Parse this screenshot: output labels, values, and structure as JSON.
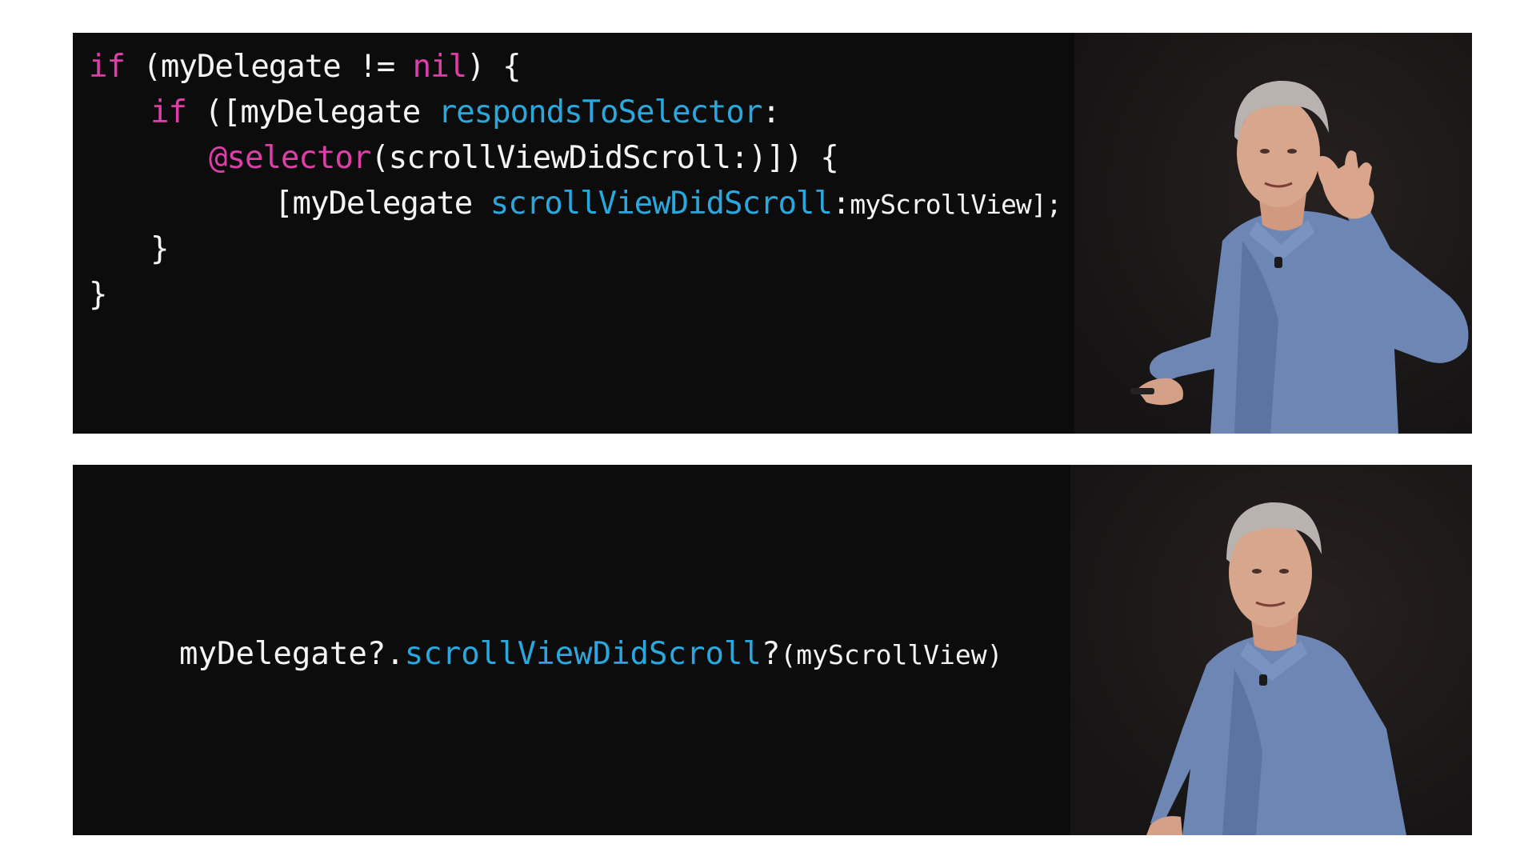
{
  "slide_1": {
    "lines": [
      {
        "k1": "if",
        "t1": " (myDelegate != ",
        "k2": "nil",
        "t2": ") {"
      },
      {
        "k1": "if",
        "t1": " ([myDelegate ",
        "f1": "respondsToSelector",
        "t2": ":"
      },
      {
        "k1": "@selector",
        "t1": "(scrollViewDidScroll:)]) {"
      },
      {
        "t1": "[myDelegate ",
        "f1": "scrollViewDidScroll",
        "t2": ":",
        "a1": "myScrollView];"
      },
      {
        "t1": "}"
      },
      {
        "t1": "}"
      }
    ]
  },
  "slide_2": {
    "line": {
      "t1": "myDelegate?.",
      "f1": "scrollViewDidScroll",
      "t2": "?",
      "a1": "(myScrollView)"
    }
  },
  "colors": {
    "keyword": "#dd3fa9",
    "function": "#2aa8dd",
    "text": "#f4f4f4",
    "slide_background": "#0c0c0d",
    "stage_background": "#191718",
    "page_background": "#ffffff"
  },
  "presenter_images": [
    "presenter-gesturing",
    "presenter-standing"
  ]
}
